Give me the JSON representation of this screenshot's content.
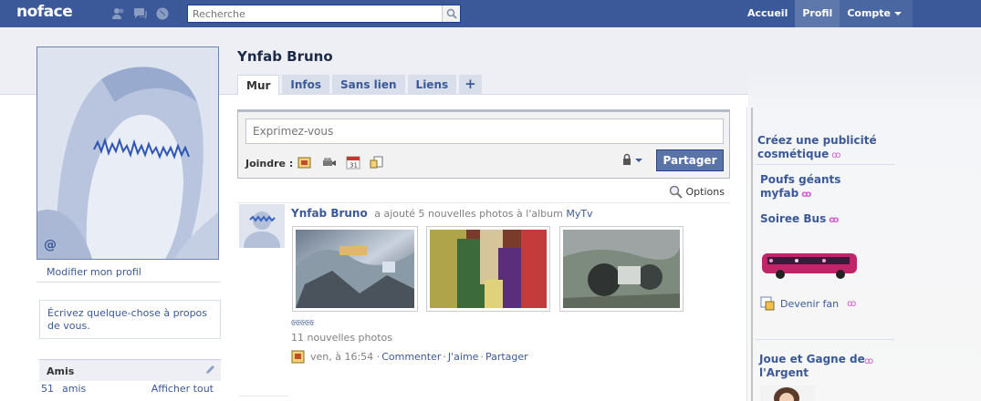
{
  "topbar": {
    "logo": "noface",
    "search_placeholder": "Recherche",
    "nav": [
      "Accueil",
      "Profil",
      "Compte"
    ]
  },
  "left": {
    "photo_badge": "@",
    "edit_profile": "Modifier mon profil",
    "about_prompt": "Écrivez quelque-chose à propos de vous.",
    "friends_header": "Amis",
    "friends_count": "51",
    "friends_word": "amis",
    "friends_show_all": "Afficher tout"
  },
  "profile": {
    "name": "Ynfab Bruno",
    "tabs": [
      "Mur",
      "Infos",
      "Sans lien",
      "Liens",
      "+"
    ]
  },
  "composer": {
    "placeholder": "Exprimez-vous",
    "attach_label": "Joindre :",
    "share_button": "Partager"
  },
  "feed": {
    "options": "Options",
    "story": {
      "author": "Ynfab Bruno",
      "action": "a ajouté 5 nouvelles photos à l'album",
      "album": "MyTv",
      "stamp": "𝔈𝔈𝔈𝔈𝔈",
      "photo_count": "11 nouvelles photos",
      "time": "ven, à 16:54",
      "comment": "Commenter",
      "like": "J'aime",
      "share": "Partager"
    }
  },
  "ads": {
    "create_ad": "Créez une publicité cosmétique",
    "item1": "Poufs géants myfab",
    "item2": "Soiree Bus",
    "become_fan": "Devenir fan",
    "item3": "Joue et Gagne de l'Argent"
  },
  "colors": {
    "brand": "#3b5998",
    "band": "#edeff4",
    "heart": "#d25ecf"
  }
}
